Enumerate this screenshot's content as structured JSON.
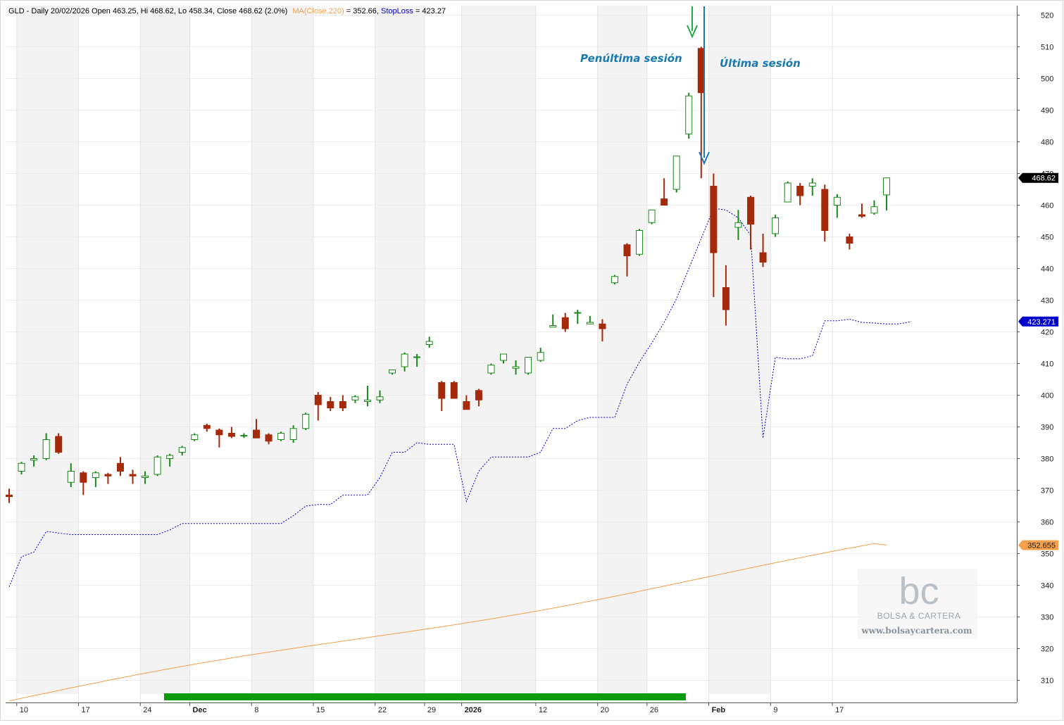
{
  "header": {
    "ticker_info": "GLD - Daily 20/02/2026 Open 463.25, Hi 468.62, Lo 458.34, Close 468.62 (2.0%)",
    "ma_label": "MA(Close,220)",
    "ma_value": " = 352.66, ",
    "sl_label": "StopLoss",
    "sl_value": " = 423.27"
  },
  "annotations": {
    "penultimate": "Penúltima sesión",
    "last": "Última sesión"
  },
  "price_tags": {
    "close": "468.62",
    "stoploss": "423.271",
    "ma": "352.655"
  },
  "watermark": {
    "logo": "bc",
    "name": "BOLSA & CARTERA",
    "url": "www.bolsaycartera.com"
  },
  "colors": {
    "up": "#1a8a1a",
    "down": "#a52a0a",
    "ma": "#f5a04a",
    "stoploss": "#0000cc",
    "close_tag": "#000000",
    "sl_tag": "#0000cc",
    "ma_tag": "#f5a04a",
    "green_arrow": "#22aa44",
    "blue_arrow": "#1a7ab0",
    "annot": "#1a7ab0",
    "trend_bar": "#0a9a0a"
  },
  "chart_data": {
    "type": "candlestick",
    "y_ticks": [
      310,
      320,
      330,
      340,
      350,
      360,
      370,
      380,
      390,
      400,
      410,
      420,
      430,
      440,
      450,
      460,
      470,
      480,
      490,
      500,
      510,
      520
    ],
    "ylim": [
      303,
      523
    ],
    "x_ticks": [
      {
        "label": "10",
        "bold": false
      },
      {
        "label": "17",
        "bold": false
      },
      {
        "label": "24",
        "bold": false
      },
      {
        "label": "Dec",
        "bold": true
      },
      {
        "label": "8",
        "bold": false
      },
      {
        "label": "15",
        "bold": false
      },
      {
        "label": "22",
        "bold": false
      },
      {
        "label": "29",
        "bold": false
      },
      {
        "label": "2026",
        "bold": true
      },
      {
        "label": "12",
        "bold": false
      },
      {
        "label": "20",
        "bold": false
      },
      {
        "label": "26",
        "bold": false
      },
      {
        "label": "Feb",
        "bold": true
      },
      {
        "label": "9",
        "bold": false
      },
      {
        "label": "17",
        "bold": false
      }
    ],
    "candles": [
      [
        368.5,
        370.5,
        366,
        368.0
      ],
      [
        376,
        379,
        375,
        378.5
      ],
      [
        379.5,
        381,
        377.5,
        380
      ],
      [
        380,
        388,
        379.5,
        386
      ],
      [
        387,
        388,
        381.5,
        382
      ],
      [
        372.5,
        378.5,
        371,
        376
      ],
      [
        375.5,
        376,
        368.5,
        372.5
      ],
      [
        374,
        376,
        371,
        375.5
      ],
      [
        375,
        375.5,
        372,
        374.5
      ],
      [
        378.5,
        380.5,
        374.5,
        376
      ],
      [
        375,
        376.5,
        372,
        374.5
      ],
      [
        374,
        376,
        372,
        374.5
      ],
      [
        375,
        381,
        374.5,
        380.5
      ],
      [
        380,
        381.5,
        377.5,
        381
      ],
      [
        382,
        384,
        381,
        383.5
      ],
      [
        386,
        388,
        385.5,
        387.5
      ],
      [
        390.5,
        391,
        388.5,
        389.5
      ],
      [
        389,
        389.5,
        383.5,
        387.5
      ],
      [
        388,
        390,
        386.5,
        387
      ],
      [
        387,
        388,
        386.5,
        387.2
      ],
      [
        389,
        392.5,
        386.5,
        386.5
      ],
      [
        387.5,
        388,
        384.5,
        385.5
      ],
      [
        386,
        388.5,
        385.5,
        388
      ],
      [
        386,
        390.5,
        385,
        389.5
      ],
      [
        389.5,
        394.5,
        389,
        394
      ],
      [
        400,
        401,
        392,
        397
      ],
      [
        398,
        399.5,
        395,
        396
      ],
      [
        398,
        400,
        395,
        396
      ],
      [
        398.5,
        400,
        397.5,
        399.5
      ],
      [
        398,
        403,
        396.5,
        398.5
      ],
      [
        398.5,
        401.5,
        397.5,
        399.5
      ],
      [
        407,
        408,
        406.5,
        408
      ],
      [
        409,
        413.5,
        407.5,
        413
      ],
      [
        412,
        413,
        409,
        412
      ],
      [
        416,
        418.5,
        415,
        417
      ],
      [
        404,
        404.5,
        395,
        399
      ],
      [
        404,
        404.5,
        399,
        399
      ],
      [
        398,
        400,
        395.5,
        395.5
      ],
      [
        401.5,
        402,
        396.5,
        398.5
      ],
      [
        407,
        410,
        406.5,
        409.5
      ],
      [
        411,
        413,
        410,
        413
      ],
      [
        408.5,
        411,
        406.5,
        409
      ],
      [
        407,
        407.5,
        406.5,
        412
      ],
      [
        411,
        415,
        410.5,
        413.5
      ],
      [
        421.5,
        425.5,
        421.5,
        422
      ],
      [
        424.5,
        426,
        420,
        421
      ],
      [
        426,
        427,
        422.5,
        426
      ],
      [
        422.5,
        425,
        422.5,
        423
      ],
      [
        422.5,
        424,
        417,
        421
      ],
      [
        435.5,
        438,
        435,
        437.5
      ],
      [
        447.5,
        448,
        437.5,
        444
      ],
      [
        444.5,
        452.5,
        444,
        452
      ],
      [
        454.5,
        458.5,
        454,
        458.5
      ],
      [
        462,
        468.5,
        460.5,
        460
      ],
      [
        465,
        475.5,
        464,
        475.5
      ],
      [
        482.5,
        495.5,
        481,
        494.5
      ],
      [
        509.5,
        510,
        468.5,
        495.5
      ],
      [
        466,
        470,
        431,
        445
      ],
      [
        434,
        441,
        422,
        427
      ],
      [
        453,
        458.5,
        449,
        454.5
      ],
      [
        462.5,
        463,
        446,
        454
      ],
      [
        445,
        451,
        440.5,
        442
      ],
      [
        451,
        457,
        450,
        456
      ],
      [
        461,
        467.5,
        461,
        467
      ],
      [
        466,
        467,
        460,
        463
      ],
      [
        466,
        468.5,
        463,
        467
      ],
      [
        465,
        466.5,
        448.5,
        452
      ],
      [
        460,
        463.5,
        456,
        462.5
      ],
      [
        450,
        451,
        446,
        448
      ],
      [
        457,
        460.5,
        456,
        456.5
      ],
      [
        457.5,
        461.5,
        457,
        459.5
      ],
      [
        463.25,
        468.62,
        458.34,
        468.62
      ]
    ],
    "ma_220": [
      303.5,
      352.66
    ],
    "stoploss": [
      339.5,
      349,
      350.5,
      357,
      356.5,
      356,
      356,
      356,
      356,
      356,
      356,
      356,
      356,
      357.5,
      359.5,
      359.5,
      359.5,
      359.5,
      359.5,
      359.5,
      359.5,
      359.5,
      359.5,
      362,
      365,
      365.5,
      365.5,
      368.5,
      368.5,
      368.5,
      374,
      382,
      382,
      385,
      384.5,
      384.5,
      384.5,
      366.5,
      376,
      380.5,
      380.5,
      380.5,
      380.5,
      382,
      389.5,
      389.5,
      392,
      393,
      393,
      393,
      403.5,
      410.5,
      416.5,
      423,
      430.5,
      440,
      449.5,
      459,
      458.5,
      456,
      450.5,
      386.5,
      412,
      411.5,
      411.5,
      412.5,
      423.5,
      423.5,
      424,
      423,
      422.8,
      422.5,
      422.5,
      423.27
    ]
  }
}
